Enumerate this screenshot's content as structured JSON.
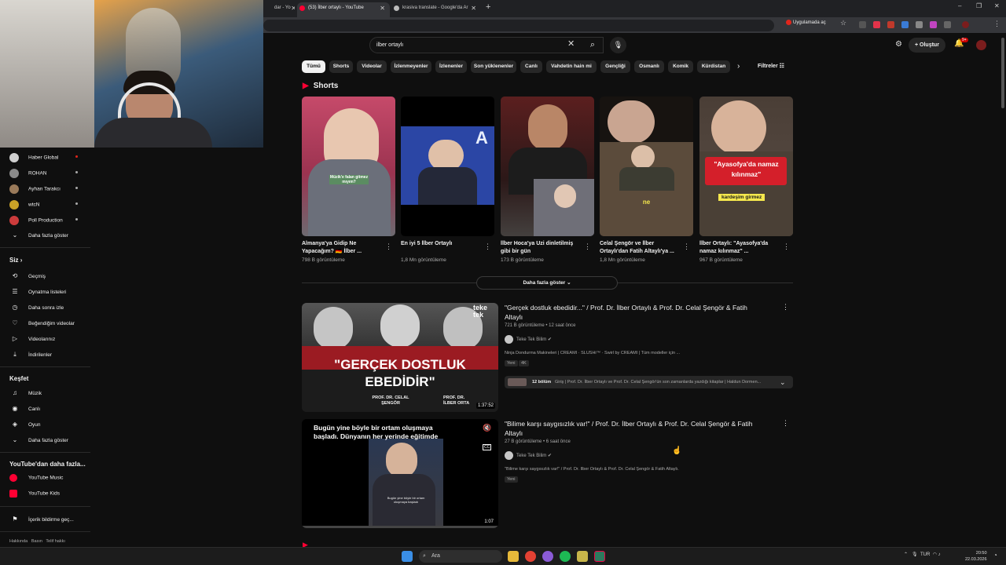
{
  "browser": {
    "tabs": [
      {
        "label": "dar - Yo",
        "active": false
      },
      {
        "label": "(53) İlber ortaylı - YouTube",
        "active": true
      },
      {
        "label": "krasiva translate - Google'da Ar",
        "active": false
      }
    ],
    "open_in_app": "Uygulamada aç"
  },
  "youtube": {
    "search_query": "ilber ortaylı",
    "create_label": "Oluştur",
    "notif_badge": "9+",
    "chips": [
      "Tümü",
      "Shorts",
      "Videolar",
      "İzlenmeyenler",
      "İzlenenler",
      "Son yüklenenler",
      "Canlı",
      "Vahdetin hain mi",
      "Gençliği",
      "Osmanlı",
      "Komik",
      "Kürdistan"
    ],
    "filters_label": "Filtreler",
    "shorts_heading": "Shorts",
    "shorts": [
      {
        "title": "Almanya'ya Gidip Ne Yapacağım? 🇩🇪 İlber ...",
        "views": "798 B görüntüleme",
        "overlay": "Müzik'e falan gitmez mıyım?",
        "bg": "#b03a5b"
      },
      {
        "title": "En iyi 5 İlber Ortaylı",
        "views": "1,8 Mn görüntüleme",
        "overlay": "",
        "bg": "#2a3d8f"
      },
      {
        "title": "İlber Hoca'ya Uzi dinletilmiş gibi bir gün",
        "views": "173 B görüntüleme",
        "overlay": "",
        "bg": "#4a2a28"
      },
      {
        "title": "Celal Şengör ve İlber Ortaylı'dan Fatih Altaylı'ya ...",
        "views": "1,8 Mn görüntüleme",
        "overlay": "ne",
        "bg": "#3b3126"
      },
      {
        "title": "İlber Ortaylı: \"Ayasofya'da namaz kılınmaz\" ...",
        "views": "967 B görüntüleme",
        "overlay": "\"Ayasofya'da namaz kılınmaz\"",
        "overlay2": "kardeşim girmez",
        "bg": "#5a4e45"
      }
    ],
    "show_more": "Daha fazla göster",
    "videos": [
      {
        "title": "\"Gerçek dostluk ebedidir...\" / Prof. Dr. İlber Ortaylı & Prof. Dr. Celal Şengör & Fatih Altaylı",
        "meta": "721 B görüntüleme • 12 saat önce",
        "channel": "Teke Tek Bilim",
        "desc": "Ninja Dondurma Makineleri | CREAMI · SLUSHi™ · Swirl by CREAMI | Tüm modeller için ...",
        "badges": [
          "Yeni",
          "4K"
        ],
        "duration": "1:37:52",
        "thumb_text": "\"GERÇEK DOSTLUK EBEDİDİR\"",
        "thumb_names": [
          "PROF. DR. CELAL ŞENGÖR",
          "PROF. DR. İLBER ORTA"
        ],
        "chapters_label": "12 bölüm",
        "chapters_text": "Giriş | Prof. Dr. İlber Ortaylı ve Prof. Dr. Celal Şengör'ün son zamanlarda yazdığı kitaplar | Haldun Dormen..."
      },
      {
        "title": "\"Bilime karşı saygısızlık var!\" / Prof. Dr. İlber Ortaylı & Prof. Dr. Celal Şengör & Fatih Altaylı",
        "meta": "27 B görüntüleme • 6 saat önce",
        "channel": "Teke Tek Bilim",
        "desc": "\"Bilime karşı saygısızlık var!\" / Prof. Dr. İlber Ortaylı & Prof. Dr. Celal Şengör & Fatih Altaylı.",
        "badges": [
          "Yeni"
        ],
        "duration": "1:07",
        "thumb_caption": "Bugün yine böyle bir ortam oluşmaya başladı. Dünyanın her yerinde eğitimde",
        "thumb_subtitle": "Bugün yine böyle bir ortam oluşmaya başladı"
      }
    ]
  },
  "sidebar": {
    "subscriptions": [
      {
        "label": "Haber Global",
        "color": "#cfcfcf"
      },
      {
        "label": "ROHAN",
        "color": "#8a8a8a"
      },
      {
        "label": "Ayhan Tarakcı",
        "color": "#9a7a5a"
      },
      {
        "label": "wtcN",
        "color": "#c9a227"
      },
      {
        "label": "Poll Production",
        "color": "#cc3b3b"
      }
    ],
    "subs_more": "Daha fazla göster",
    "you_heading": "Siz",
    "you_items": [
      {
        "label": "Geçmiş",
        "icon": "history-icon",
        "glyph": "⟲"
      },
      {
        "label": "Oynatma listeleri",
        "icon": "playlist-icon",
        "glyph": "☰"
      },
      {
        "label": "Daha sonra izle",
        "icon": "clock-icon",
        "glyph": "◷"
      },
      {
        "label": "Beğendiğim videolar",
        "icon": "like-icon",
        "glyph": "♡"
      },
      {
        "label": "Videolarınız",
        "icon": "video-icon",
        "glyph": "▷"
      },
      {
        "label": "İndirilenler",
        "icon": "download-icon",
        "glyph": "⤓"
      }
    ],
    "explore_heading": "Keşfet",
    "explore_items": [
      {
        "label": "Müzik",
        "icon": "music-icon",
        "glyph": "♫"
      },
      {
        "label": "Canlı",
        "icon": "live-icon",
        "glyph": "◉"
      },
      {
        "label": "Oyun",
        "icon": "gaming-icon",
        "glyph": "◈"
      },
      {
        "label": "Daha fazla göster",
        "icon": "chevron-down-icon",
        "glyph": "⌄"
      }
    ],
    "more_heading": "YouTube'dan daha fazla...",
    "more_items": [
      {
        "label": "YouTube Music",
        "icon": "youtube-music-icon"
      },
      {
        "label": "YouTube Kids",
        "icon": "youtube-kids-icon"
      }
    ],
    "report_history": "İçerik bildirme geç...",
    "footer_links": [
      "Hakkında",
      "Basın",
      "Telif hakkı"
    ]
  },
  "taskbar": {
    "search_label": "Ara",
    "lang": "TUR",
    "time": "20:50",
    "date": "22.03.2026"
  }
}
